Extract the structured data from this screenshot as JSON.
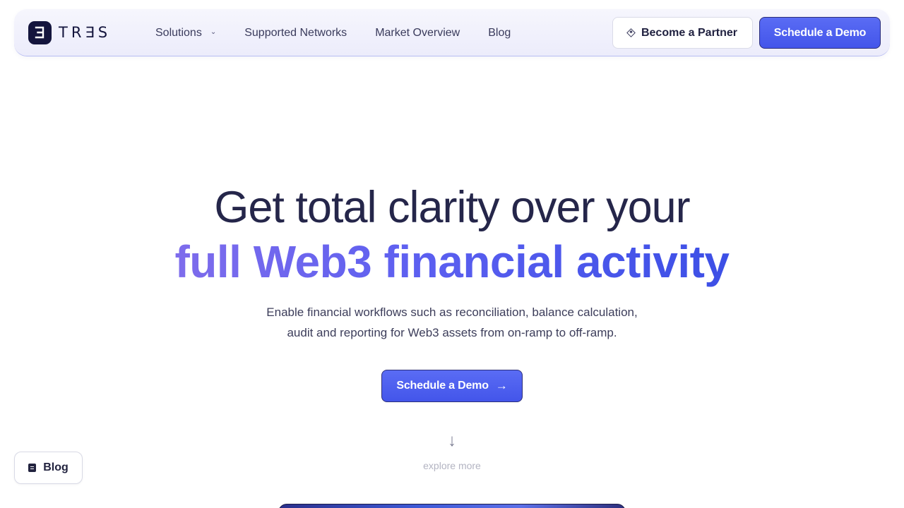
{
  "nav": {
    "brand": "TR∃S",
    "links": [
      {
        "label": "Solutions",
        "has_dropdown": true
      },
      {
        "label": "Supported Networks"
      },
      {
        "label": "Market Overview"
      },
      {
        "label": "Blog"
      }
    ],
    "partner_button": "Become a Partner",
    "demo_button": "Schedule a Demo"
  },
  "hero": {
    "title_line1": "Get total clarity over your",
    "title_line2": "full Web3 financial activity",
    "subtitle_line1": "Enable financial workflows such as reconciliation, balance calculation,",
    "subtitle_line2": "audit and reporting for Web3 assets from on-ramp to off-ramp.",
    "cta_label": "Schedule a Demo",
    "explore_label": "explore more"
  },
  "floating": {
    "blog_label": "Blog"
  },
  "icons": {
    "dropdown": "chevron-down-icon",
    "partner": "diamond-icon",
    "cta_arrow": "arrow-right-icon",
    "explore": "arrow-down-icon",
    "blog": "document-icon"
  },
  "colors": {
    "brand_dark": "#14153d",
    "accent": "#4f5fee",
    "gradient_start": "#7e6cec",
    "gradient_end": "#3c4fe6"
  }
}
